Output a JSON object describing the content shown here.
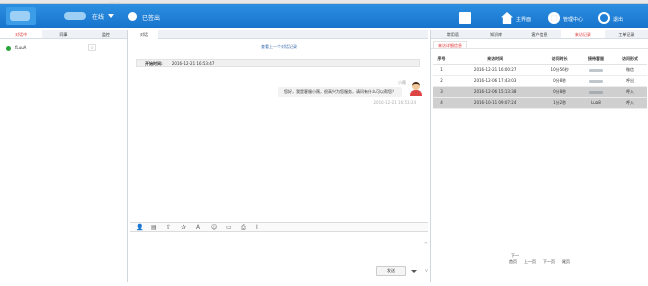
{
  "window": {
    "top_strip_text": "·····  ·····"
  },
  "header": {
    "status_label": "在线",
    "signout_label": "已签出",
    "nav": [
      {
        "icon": "book-icon",
        "label": ""
      },
      {
        "icon": "home-icon",
        "label": "主界面"
      },
      {
        "icon": "gear-icon",
        "label": "管理中心"
      },
      {
        "icon": "power-icon",
        "label": "退出"
      }
    ]
  },
  "left": {
    "tabs": [
      "对话中",
      "同事",
      "监控"
    ],
    "active_tab": 0,
    "contact": {
      "name": "fLuuA",
      "badge": "⊙",
      "status_color": "#2ba43b"
    }
  },
  "center": {
    "tab": "对话",
    "prev_link": "查看上一个对话记录",
    "start_label": "开始时间:",
    "start_value": "2016-12-21 16:53:47",
    "agent_name": "小薇",
    "message": "您好，我是客服小薇，很高兴为您服务，请问有什么可以帮您？",
    "message_time": "2016-12-21 16:53:24",
    "send_label": "发送",
    "tools": [
      "person-icon",
      "card-icon",
      "upload-icon",
      "star-icon",
      "font-icon",
      "smile-icon",
      "screenshot-icon",
      "print-icon",
      "text-icon"
    ]
  },
  "right": {
    "tabs": [
      "常用语",
      "知识库",
      "客户信息",
      "来访记录",
      "工单记录"
    ],
    "active_tab": 3,
    "subtab": "来访详细信息",
    "columns": [
      "序号",
      "来访时间",
      "访问时长",
      "接待客服",
      "访问形式"
    ],
    "rows": [
      {
        "num": "1",
        "time": "2016-12-21 16:00:27",
        "duration": "10分56秒",
        "mode": "微信",
        "shaded": false
      },
      {
        "num": "2",
        "time": "2016-12-06 17:43:03",
        "duration": "0分8秒",
        "mode": "呼出",
        "shaded": false
      },
      {
        "num": "3",
        "time": "2016-12-06 15:13:38",
        "duration": "0分8秒",
        "mode": "呼入",
        "shaded": true
      },
      {
        "num": "4",
        "time": "2016-10-11 09:07:24",
        "duration": "1分2秒",
        "agent_visible": "Lua8",
        "mode": "呼入",
        "shaded": true
      }
    ],
    "pager": {
      "first": "首页",
      "prev": "上一页",
      "next": "下一页",
      "last": "尾页",
      "hint": "下一"
    }
  }
}
